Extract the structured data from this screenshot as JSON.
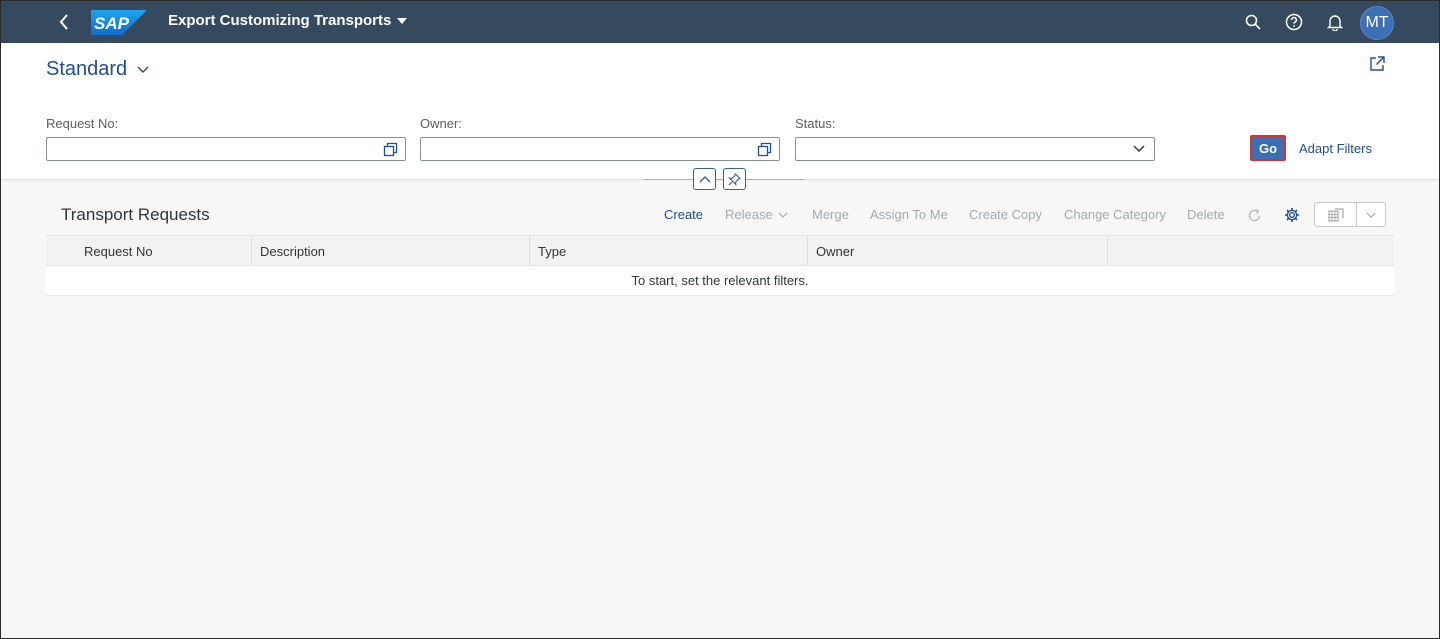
{
  "shell": {
    "app_title": "Export Customizing Transports",
    "logo_text": "SAP",
    "avatar_initials": "MT",
    "colors": {
      "bar": "#354a5f",
      "avatar": "#3b6fb6"
    }
  },
  "header": {
    "variant_name": "Standard",
    "filters": [
      {
        "label": "Request No:",
        "value": ""
      },
      {
        "label": "Owner:",
        "value": ""
      },
      {
        "label": "Status:",
        "value": ""
      }
    ],
    "go_label": "Go",
    "adapt_filters_label": "Adapt Filters"
  },
  "table": {
    "title": "Transport Requests",
    "toolbar": {
      "create": "Create",
      "release": "Release",
      "merge": "Merge",
      "assign_to_me": "Assign To Me",
      "create_copy": "Create Copy",
      "change_category": "Change Category",
      "delete": "Delete"
    },
    "columns": [
      "Request No",
      "Description",
      "Type",
      "Owner"
    ],
    "no_data_text": "To start, set the relevant filters."
  },
  "icons": [
    "back-icon",
    "search-icon",
    "help-icon",
    "bell-icon",
    "share-icon",
    "value-help-icon",
    "chevron-down-icon",
    "collapse-up-icon",
    "pin-icon",
    "refresh-icon",
    "settings-icon",
    "export-icon"
  ]
}
